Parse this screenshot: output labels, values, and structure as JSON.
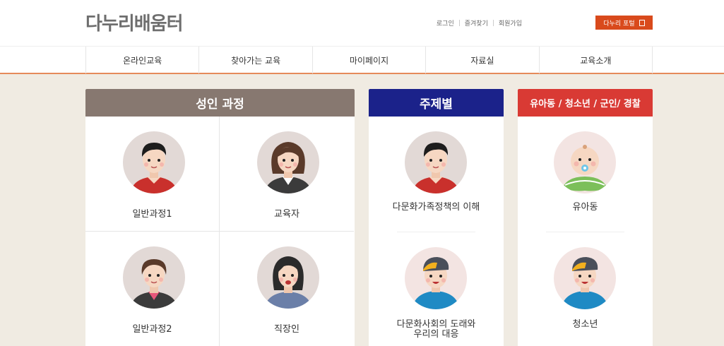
{
  "site": {
    "logo_text": "다누리배움터"
  },
  "util_links": [
    "로그인",
    "즐겨찾기",
    "회원가입"
  ],
  "portal_button": {
    "label": "다누리 포털",
    "icon": "external-link-icon"
  },
  "nav": [
    "온라인교육",
    "찾아가는 교육",
    "마이페이지",
    "자료실",
    "교육소개"
  ],
  "panels": {
    "adult": {
      "title": "성인 과정",
      "color": "#877870",
      "items": [
        {
          "label": "일반과정1",
          "icon": "man-avatar-icon"
        },
        {
          "label": "교육자",
          "icon": "woman-teacher-avatar-icon"
        },
        {
          "label": "일반과정2",
          "icon": "woman-avatar-icon"
        },
        {
          "label": "직장인",
          "icon": "office-worker-avatar-icon"
        }
      ]
    },
    "topic": {
      "title": "주제별",
      "color": "#1b228a",
      "items": [
        {
          "label": "다문화가족정책의 이해",
          "icon": "man-avatar-icon"
        },
        {
          "label_line1": "다문화사회의 도래와",
          "label_line2": "우리의 대응",
          "icon": "boy-cap-avatar-icon"
        }
      ]
    },
    "youth": {
      "title": "유아동 / 청소년 / 군인/ 경찰",
      "color": "#d93a34",
      "items": [
        {
          "label": "유아동",
          "icon": "baby-avatar-icon"
        },
        {
          "label": "청소년",
          "icon": "boy-cap-avatar-icon"
        }
      ]
    }
  }
}
